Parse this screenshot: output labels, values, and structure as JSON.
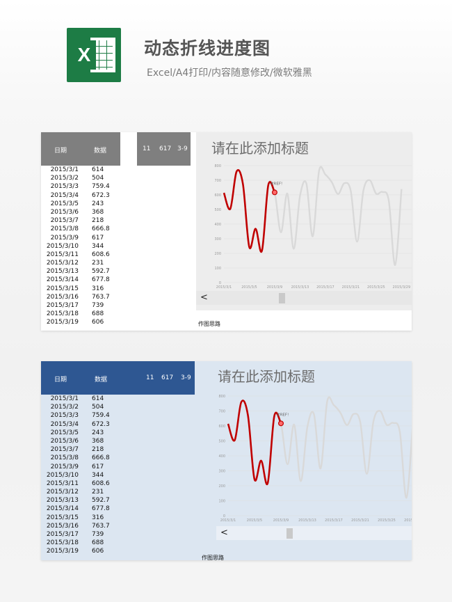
{
  "header": {
    "title": "动态折线进度图",
    "subtitle": "Excel/A4打印/内容随意修改/微软雅黑"
  },
  "table": {
    "col_date": "日期",
    "col_value": "数据",
    "controls": [
      "11",
      "617",
      "3-9"
    ],
    "rows": [
      {
        "date": "2015/3/1",
        "value": "614"
      },
      {
        "date": "2015/3/2",
        "value": "504"
      },
      {
        "date": "2015/3/3",
        "value": "759.4"
      },
      {
        "date": "2015/3/4",
        "value": "672.3"
      },
      {
        "date": "2015/3/5",
        "value": "243"
      },
      {
        "date": "2015/3/6",
        "value": "368"
      },
      {
        "date": "2015/3/7",
        "value": "218"
      },
      {
        "date": "2015/3/8",
        "value": "666.8"
      },
      {
        "date": "2015/3/9",
        "value": "617"
      },
      {
        "date": "2015/3/10",
        "value": "344"
      },
      {
        "date": "2015/3/11",
        "value": "608.6"
      },
      {
        "date": "2015/3/12",
        "value": "231"
      },
      {
        "date": "2015/3/13",
        "value": "592.7"
      },
      {
        "date": "2015/3/14",
        "value": "677.8"
      },
      {
        "date": "2015/3/15",
        "value": "316"
      },
      {
        "date": "2015/3/16",
        "value": "763.7"
      },
      {
        "date": "2015/3/17",
        "value": "739"
      },
      {
        "date": "2015/3/18",
        "value": "688"
      },
      {
        "date": "2015/3/19",
        "value": "606"
      }
    ]
  },
  "chart": {
    "title": "请在此添加标题",
    "marker_label": "#REF!",
    "note": "作图思路",
    "scroll_left": "<"
  },
  "chart_data": {
    "type": "line",
    "ylim": [
      0,
      800
    ],
    "yticks": [
      "0",
      "100",
      "200",
      "300",
      "400",
      "500",
      "600",
      "700",
      "800"
    ],
    "xticks": [
      "2015/3/1",
      "2015/3/5",
      "2015/3/9",
      "2015/3/13",
      "2015/3/17",
      "2015/3/21",
      "2015/3/25",
      "2015/3/29"
    ],
    "highlight_count": 9,
    "series": [
      {
        "values": [
          614,
          504,
          759.4,
          672.3,
          243,
          368,
          218,
          666.8,
          617,
          344,
          608.6,
          231,
          592.7,
          677.8,
          316,
          763.7,
          739,
          688,
          606,
          680,
          627,
          280,
          630,
          700,
          608,
          620,
          560,
          120,
          640
        ]
      }
    ],
    "colors": {
      "highlight": "#c00000",
      "rest": "#d9d9d9",
      "grid": "#dedede"
    }
  }
}
